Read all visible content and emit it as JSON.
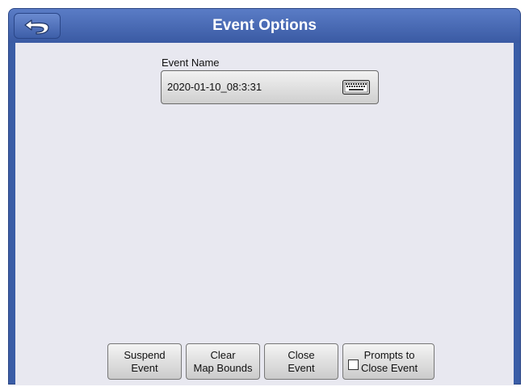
{
  "window": {
    "title": "Event Options"
  },
  "event_name": {
    "label": "Event Name",
    "value": "2020-01-10_08:3:31"
  },
  "buttons": {
    "suspend": "Suspend\nEvent",
    "clear": "Clear\nMap Bounds",
    "close": "Close\nEvent",
    "prompts": "Prompts to\nClose Event"
  },
  "prompts_checked": false,
  "icons": {
    "back": "back-arrow-icon",
    "keyboard": "keyboard-icon"
  },
  "colors": {
    "title_bar": "#3a5da6",
    "content_bg": "#e8e8f0"
  }
}
